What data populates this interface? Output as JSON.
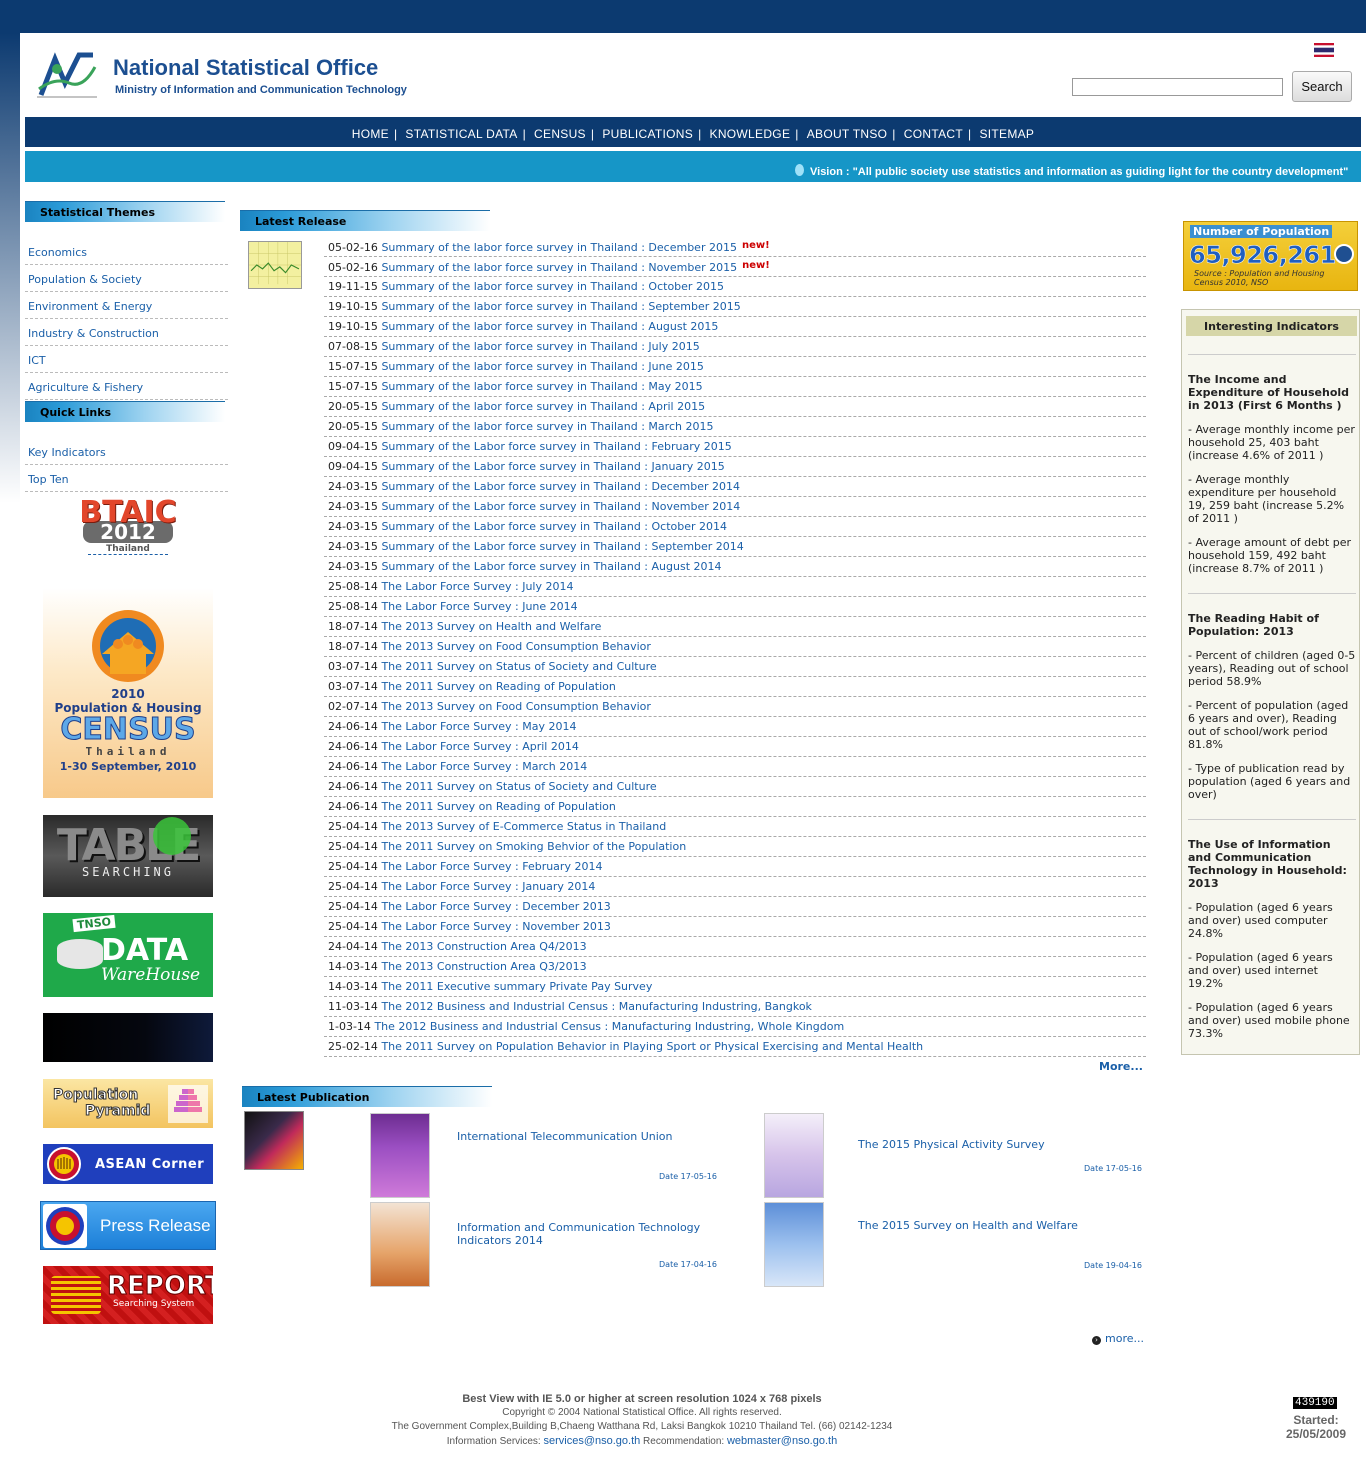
{
  "header": {
    "title": "National Statistical Office",
    "subtitle": "Ministry of Information and Communication Technology",
    "search_button": "Search",
    "search_value": ""
  },
  "nav": [
    "HOME",
    "STATISTICAL DATA",
    "CENSUS",
    "PUBLICATIONS",
    "KNOWLEDGE",
    "ABOUT TNSO",
    "CONTACT",
    "SITEMAP"
  ],
  "vision": "Vision : \"All public society use statistics and information as guiding light for the country development\"",
  "sidebar": {
    "themes_title": "Statistical Themes",
    "themes": [
      "Economics",
      "Population & Society",
      "Environment & Energy",
      "Industry & Construction",
      "ICT",
      "Agriculture & Fishery"
    ],
    "quick_title": "Quick Links",
    "quick": [
      "Key Indicators",
      "Top Ten"
    ],
    "banners": {
      "btaic_title": "BTAIC",
      "btaic_year": "2012",
      "btaic_country": "Thailand",
      "census_year": "2010",
      "census_line1": "Population & Housing",
      "census_word": "CENSUS",
      "census_country": "Thailand",
      "census_dates": "1-30 September, 2010",
      "table_word": "TABLE",
      "table_sub": "SEARCHING",
      "dw_tnso": "TNSO",
      "dw_data": "DATA",
      "dw_warehouse": "WareHouse",
      "pyramid_line1": "Population",
      "pyramid_line2": "Pyramid",
      "asean": "ASEAN Corner",
      "press": "Press Release",
      "report": "REPORT",
      "report_sub": "Searching System"
    }
  },
  "latest_release": {
    "title": "Latest Release",
    "more": "More...",
    "new_label": "new!",
    "items": [
      {
        "date": "05-02-16",
        "text": "Summary of the labor force survey in Thailand : December 2015",
        "is_new": true
      },
      {
        "date": "05-02-16",
        "text": "Summary of the labor force survey in Thailand : November 2015",
        "is_new": true
      },
      {
        "date": "19-11-15",
        "text": "Summary of the labor force survey in Thailand : October 2015"
      },
      {
        "date": "19-10-15",
        "text": "Summary of the labor force survey in Thailand : September 2015"
      },
      {
        "date": "19-10-15",
        "text": "Summary of the labor force survey in Thailand : August 2015"
      },
      {
        "date": "07-08-15",
        "text": "Summary of the labor force survey in Thailand : July 2015"
      },
      {
        "date": "15-07-15",
        "text": "Summary of the labor force survey in Thailand : June 2015"
      },
      {
        "date": "15-07-15",
        "text": "Summary of the labor force survey in Thailand : May 2015"
      },
      {
        "date": "20-05-15",
        "text": "Summary of the labor force survey in Thailand : April 2015"
      },
      {
        "date": "20-05-15",
        "text": "Summary of the labor force survey in Thailand : March 2015"
      },
      {
        "date": "09-04-15",
        "text": "Summary of the Labor force survey in Thailand : February 2015"
      },
      {
        "date": "09-04-15",
        "text": "Summary of the Labor force survey in Thailand : January 2015"
      },
      {
        "date": "24-03-15",
        "text": "Summary of the Labor force survey in Thailand : December 2014"
      },
      {
        "date": "24-03-15",
        "text": "Summary of the Labor force survey in Thailand : November 2014"
      },
      {
        "date": "24-03-15",
        "text": "Summary of the Labor force survey in Thailand : October 2014"
      },
      {
        "date": "24-03-15",
        "text": "Summary of the Labor force survey in Thailand : September 2014"
      },
      {
        "date": "24-03-15",
        "text": "Summary of the Labor force survey in Thailand : August 2014"
      },
      {
        "date": "25-08-14",
        "text": "The Labor Force Survey : July 2014"
      },
      {
        "date": "25-08-14",
        "text": "The Labor Force Survey : June 2014"
      },
      {
        "date": "18-07-14",
        "text": "The 2013 Survey on Health and Welfare"
      },
      {
        "date": "18-07-14",
        "text": "The 2013 Survey on Food Consumption Behavior"
      },
      {
        "date": "03-07-14",
        "text": "The 2011 Survey on Status of Society and Culture"
      },
      {
        "date": "03-07-14",
        "text": "The 2011 Survey on Reading of Population"
      },
      {
        "date": "02-07-14",
        "text": "The 2013 Survey on Food Consumption Behavior"
      },
      {
        "date": "24-06-14",
        "text": "The Labor Force Survey : May 2014"
      },
      {
        "date": "24-06-14",
        "text": "The Labor Force Survey : April 2014"
      },
      {
        "date": "24-06-14",
        "text": "The Labor Force Survey : March 2014"
      },
      {
        "date": "24-06-14",
        "text": "The 2011 Survey on Status of Society and Culture"
      },
      {
        "date": "24-06-14",
        "text": "The 2011 Survey on Reading of Population"
      },
      {
        "date": "25-04-14",
        "text": "The 2013 Survey of E-Commerce Status in Thailand"
      },
      {
        "date": "25-04-14",
        "text": "The 2011 Survey on Smoking Behvior of the Population"
      },
      {
        "date": "25-04-14",
        "text": "The Labor Force Survey : February 2014"
      },
      {
        "date": "25-04-14",
        "text": "The Labor Force Survey : January 2014"
      },
      {
        "date": "25-04-14",
        "text": "The Labor Force Survey : December 2013"
      },
      {
        "date": "25-04-14",
        "text": "The Labor Force Survey : November 2013"
      },
      {
        "date": "24-04-14",
        "text": "The 2013 Construction Area Q4/2013"
      },
      {
        "date": "14-03-14",
        "text": "The 2013 Construction Area Q3/2013"
      },
      {
        "date": "14-03-14",
        "text": "The 2011 Executive summary Private Pay Survey"
      },
      {
        "date": "11-03-14",
        "text": "The 2012 Business and Industrial Census : Manufacturing Industring, Bangkok"
      },
      {
        "date": "1-03-14",
        "text": "The 2012 Business and Industrial Census : Manufacturing Industring, Whole Kingdom"
      },
      {
        "date": "25-02-14",
        "text": "The 2011 Survey on Population Behavior in Playing Sport or Physical Exercising and Mental Health"
      }
    ]
  },
  "latest_publication": {
    "title": "Latest Publication",
    "more": "more...",
    "items": [
      {
        "title": "International Telecommunication Union",
        "date": "Date 17-05-16"
      },
      {
        "title": "The 2015 Physical Activity Survey",
        "date": "Date 17-05-16"
      },
      {
        "title": "Information and Communication Technology Indicators 2014",
        "date": "Date 17-04-16"
      },
      {
        "title": "The 2015 Survey on Health and Welfare",
        "date": "Date 19-04-16"
      }
    ]
  },
  "population_box": {
    "label": "Number of Population",
    "value": "65,926,261",
    "source": "Source : Population and Housing Census 2010, NSO"
  },
  "indicators": {
    "title": "Interesting Indicators",
    "groups": [
      {
        "heading": "The Income and Expenditure of Household in 2013 (First 6 Months )",
        "points": [
          "- Average monthly income per household 25, 403 baht (increase 4.6% of 2011 )",
          "- Average monthly expenditure per household 19, 259 baht (increase 5.2% of 2011 )",
          "- Average amount of debt per household 159, 492 baht (increase 8.7% of 2011 )"
        ]
      },
      {
        "heading": "The Reading Habit of Population: 2013",
        "points": [
          "- Percent of children (aged 0-5 years), Reading out of school period 58.9%",
          "- Percent of population (aged 6 years and over), Reading out of school/work period 81.8%",
          "- Type of publication read by population (aged 6 years and over)"
        ]
      },
      {
        "heading": "The Use of Information and Communication Technology in Household: 2013",
        "points": [
          "- Population (aged 6 years and over) used computer 24.8%",
          "- Population (aged 6 years and over) used internet 19.2%",
          "- Population (aged 6 years and over) used mobile phone 73.3%"
        ]
      }
    ]
  },
  "footer": {
    "best_view": "Best View with IE 5.0 or higher at screen resolution 1024 x 768 pixels",
    "copyright": "Copyright © 2004 National Statistical Office. All rights reserved.",
    "address": "The Government Complex,Building B,Chaeng Watthana Rd, Laksi Bangkok 10210 Thailand Tel. (66) 02142-1234",
    "info_label": "Information Services:",
    "info_email": "services@nso.go.th",
    "rec_label": "Recommendation:",
    "rec_email": "webmaster@nso.go.th",
    "counter": "439190",
    "started_label": "Started:",
    "started_date": "25/05/2009"
  },
  "colors": {
    "navy": "#0c3a70",
    "vision": "#1696c7",
    "link": "#1a5fa8"
  }
}
